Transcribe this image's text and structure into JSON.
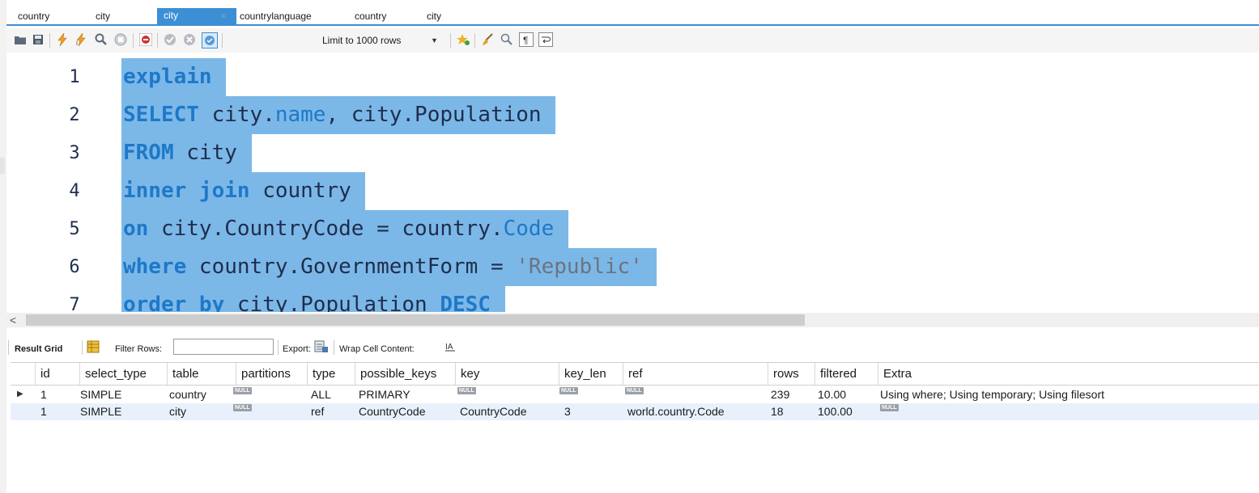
{
  "tabs": [
    {
      "label": "country"
    },
    {
      "label": "city"
    },
    {
      "label": "city",
      "active": true
    },
    {
      "label": "countrylanguage"
    },
    {
      "label": "country"
    },
    {
      "label": "city"
    }
  ],
  "tab_close": "×",
  "toolbar": {
    "limit_label": "Limit to 1000 rows",
    "icons": [
      "open-folder-icon",
      "save-icon",
      "execute-icon",
      "execute-current-icon",
      "explain-icon",
      "stop-icon",
      "toggle-error-icon",
      "commit-icon",
      "rollback-icon",
      "autocommit-icon",
      "beautify-star-icon",
      "clear-brush-icon",
      "find-icon",
      "invisible-chars-icon",
      "wrap-icon"
    ]
  },
  "editor": {
    "lines": [
      {
        "num": "1",
        "segments": [
          {
            "t": "explain",
            "c": "kw"
          },
          {
            "t": " ",
            "c": ""
          }
        ]
      },
      {
        "num": "2",
        "segments": [
          {
            "t": "SELECT",
            "c": "kw"
          },
          {
            "t": " city.",
            "c": ""
          },
          {
            "t": "name",
            "c": "kw2"
          },
          {
            "t": ", city.Population ",
            "c": ""
          }
        ]
      },
      {
        "num": "3",
        "segments": [
          {
            "t": "FROM",
            "c": "kw"
          },
          {
            "t": " city ",
            "c": ""
          }
        ]
      },
      {
        "num": "4",
        "segments": [
          {
            "t": "inner join",
            "c": "kw"
          },
          {
            "t": " country ",
            "c": ""
          }
        ]
      },
      {
        "num": "5",
        "segments": [
          {
            "t": "on",
            "c": "kw"
          },
          {
            "t": " city.CountryCode = country.",
            "c": ""
          },
          {
            "t": "Code",
            "c": "kw2"
          },
          {
            "t": " ",
            "c": ""
          }
        ]
      },
      {
        "num": "6",
        "segments": [
          {
            "t": "where",
            "c": "kw"
          },
          {
            "t": " country.GovernmentForm = ",
            "c": ""
          },
          {
            "t": "'Republic'",
            "c": "str"
          },
          {
            "t": " ",
            "c": ""
          }
        ]
      },
      {
        "num": "7",
        "segments": [
          {
            "t": "order by",
            "c": "kw"
          },
          {
            "t": " city.Population ",
            "c": ""
          },
          {
            "t": "DESC",
            "c": "kw"
          },
          {
            "t": " ",
            "c": ""
          }
        ]
      }
    ]
  },
  "scroll_left_arrow": "<",
  "results_toolbar": {
    "result_grid": "Result Grid",
    "filter_rows": "Filter Rows:",
    "filter_value": "",
    "export": "Export:",
    "wrap": "Wrap Cell Content:"
  },
  "grid": {
    "columns": [
      "id",
      "select_type",
      "table",
      "partitions",
      "type",
      "possible_keys",
      "key",
      "key_len",
      "ref",
      "rows",
      "filtered",
      "Extra"
    ],
    "rows": [
      [
        "1",
        "SIMPLE",
        "country",
        "NULL",
        "ALL",
        "PRIMARY",
        "NULL",
        "NULL",
        "NULL",
        "239",
        "10.00",
        "Using where; Using temporary; Using filesort"
      ],
      [
        "1",
        "SIMPLE",
        "city",
        "NULL",
        "ref",
        "CountryCode",
        "CountryCode",
        "3",
        "world.country.Code",
        "18",
        "100.00",
        "NULL"
      ]
    ],
    "current_row_marker": "▶"
  }
}
